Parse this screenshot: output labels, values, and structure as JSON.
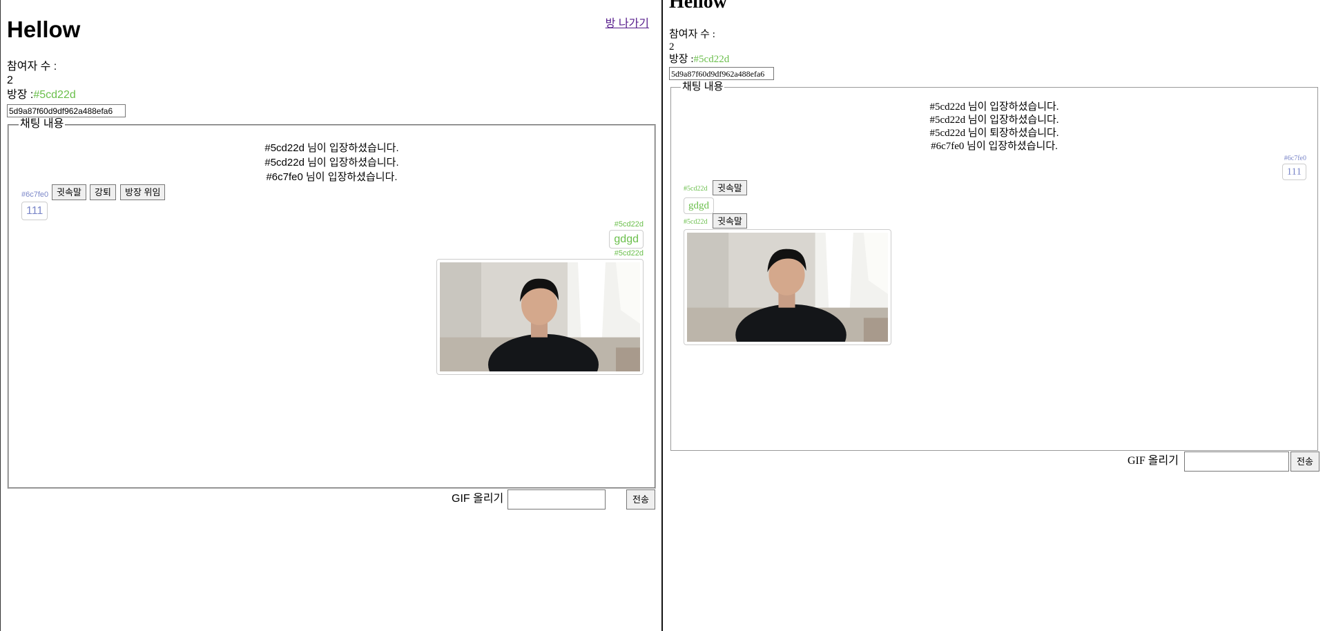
{
  "left": {
    "title": "Hellow",
    "leave_link": "방 나가기",
    "participants_label": "참여자 수 :",
    "participants_count": "2",
    "host_label": "방장 :",
    "host_id": "#5cd22d",
    "room_id": "5d9a87f60d9df962a488efa6",
    "chat_legend": "채팅 내용",
    "system_messages": [
      "#5cd22d 님이 입장하셨습니다.",
      "#5cd22d 님이 입장하셨습니다.",
      "#6c7fe0 님이 입장하셨습니다."
    ],
    "msg1": {
      "sender": "#6c7fe0",
      "buttons": [
        "귓속말",
        "강퇴",
        "방장 위임"
      ],
      "text": "111"
    },
    "msg2": {
      "sender": "#5cd22d",
      "text": "gdgd"
    },
    "msg3": {
      "sender": "#5cd22d"
    },
    "gif_label": "GIF 올리기",
    "gif_input_value": "",
    "send_button": "전송"
  },
  "right": {
    "title": "Hellow",
    "participants_label": "참여자 수 :",
    "participants_count": "2",
    "host_label": "방장 :",
    "host_id": "#5cd22d",
    "room_id": "5d9a87f60d9df962a488efa6",
    "chat_legend": "채팅 내용",
    "system_messages": [
      "#5cd22d 님이 입장하셨습니다.",
      "#5cd22d 님이 입장하셨습니다.",
      "#5cd22d 님이 퇴장하셨습니다.",
      "#6c7fe0 님이 입장하셨습니다."
    ],
    "msg1": {
      "sender": "#6c7fe0",
      "text": "111"
    },
    "msg2": {
      "sender": "#5cd22d",
      "button": "귓속말",
      "text": "gdgd"
    },
    "msg3": {
      "sender": "#5cd22d",
      "button": "귓속말"
    },
    "gif_label": "GIF 올리기",
    "gif_input_value": "",
    "send_button": "전송"
  },
  "colors": {
    "host_green": "#6abf4b",
    "user_blue": "#7a86c8",
    "link_purple": "#551a8b"
  }
}
